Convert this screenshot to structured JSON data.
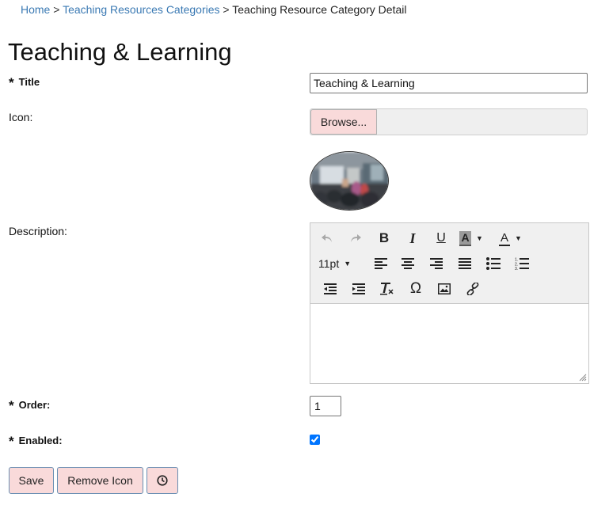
{
  "breadcrumb": {
    "home": "Home",
    "categories": "Teaching Resources Categories",
    "current": "Teaching Resource Category Detail",
    "separator": ">"
  },
  "page_title": "Teaching & Learning",
  "form": {
    "required_marker": "*",
    "title_label": "Title",
    "title_value": "Teaching & Learning",
    "icon_label": "Icon:",
    "browse_label": "Browse...",
    "icon_preview": "classroom-photo",
    "description_label": "Description:",
    "description_value": "",
    "order_label": "Order:",
    "order_value": "1",
    "enabled_label": "Enabled:",
    "enabled_checked": true
  },
  "editor_toolbar": {
    "font_size": "11pt",
    "icons": [
      "undo-icon",
      "redo-icon",
      "bold-icon",
      "italic-icon",
      "underline-icon",
      "background-color-icon",
      "text-color-icon",
      "align-left-icon",
      "align-center-icon",
      "align-right-icon",
      "align-justify-icon",
      "bullet-list-icon",
      "numbered-list-icon",
      "outdent-icon",
      "indent-icon",
      "clear-formatting-icon",
      "special-character-icon",
      "image-icon",
      "link-icon"
    ]
  },
  "buttons": {
    "save": "Save",
    "remove_icon": "Remove Icon",
    "history_icon": "clock-icon"
  },
  "colors": {
    "link": "#3a79b3",
    "button_bg": "#f9dada",
    "button_border": "#6a8fb3",
    "checkbox": "#0075ff"
  }
}
